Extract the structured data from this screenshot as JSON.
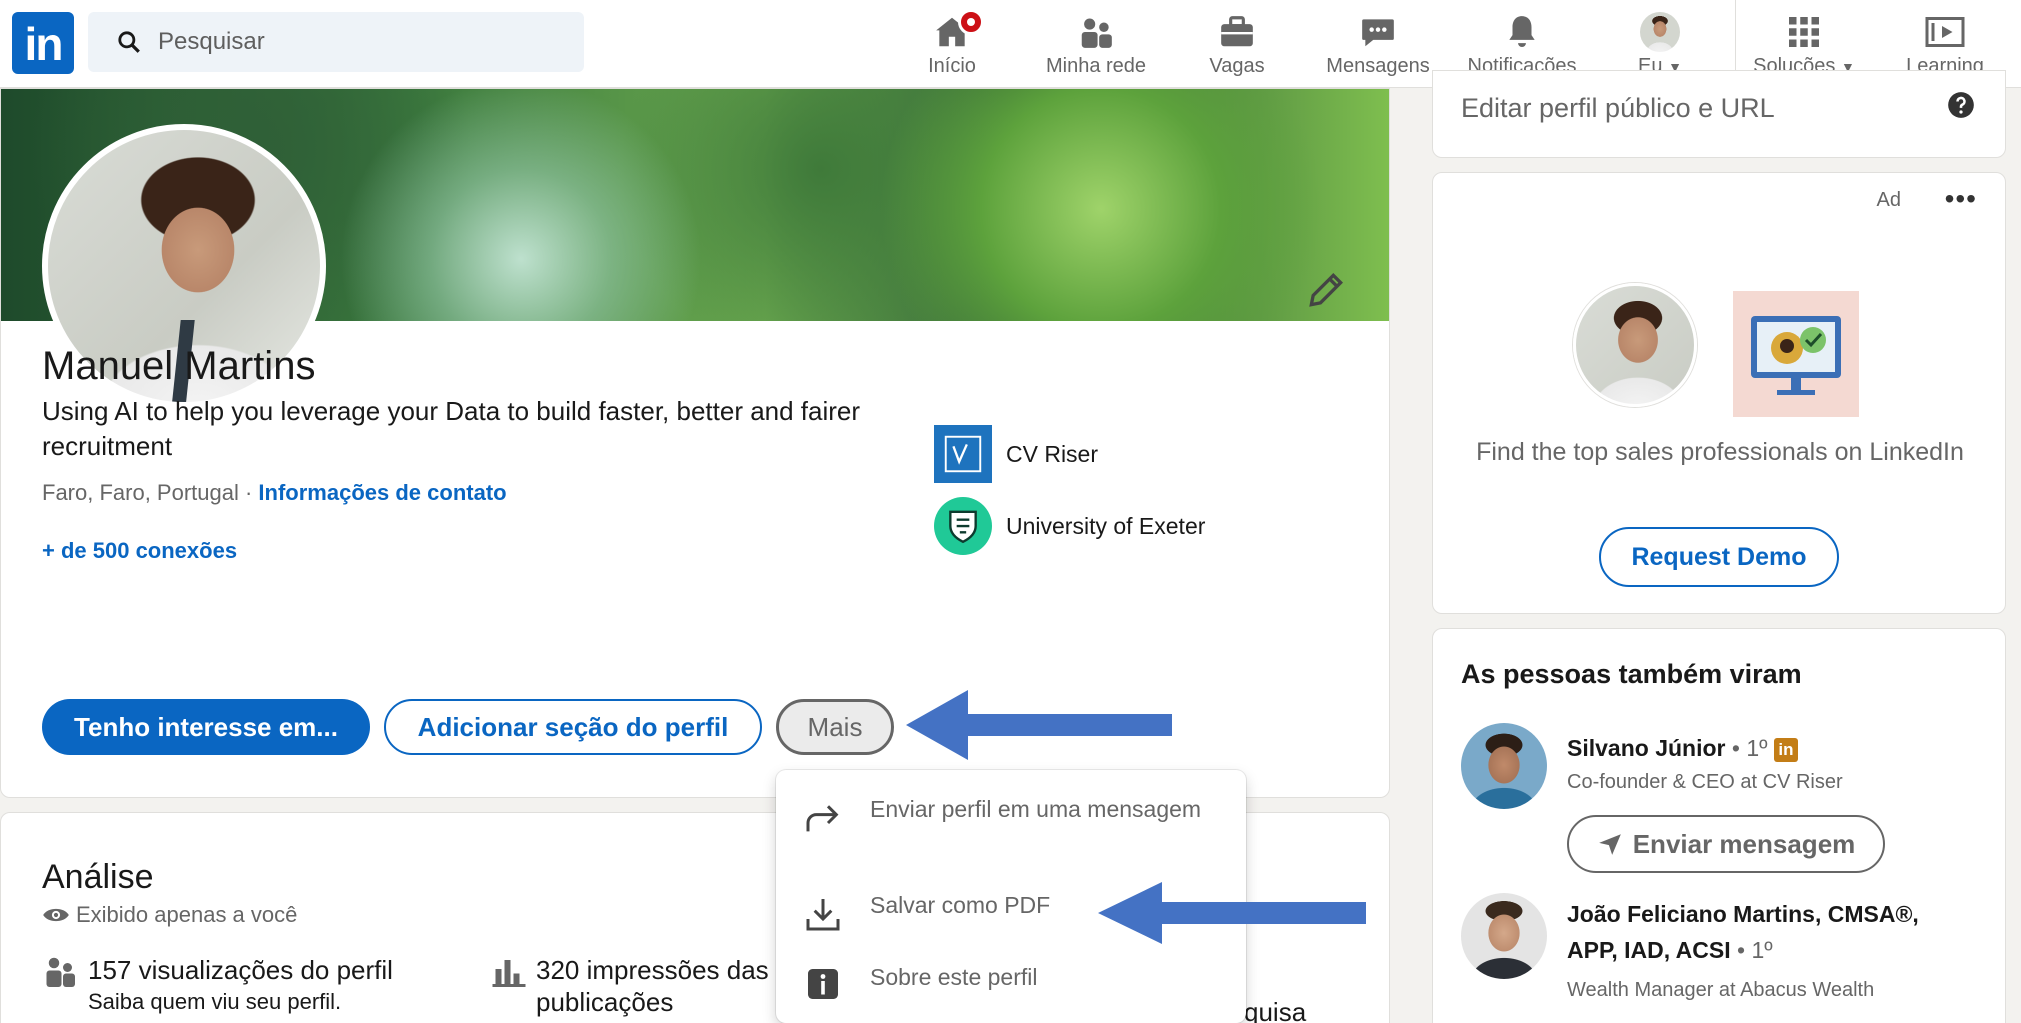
{
  "nav": {
    "search_placeholder": "Pesquisar",
    "items": [
      {
        "label": "Início",
        "icon": "home-icon"
      },
      {
        "label": "Minha rede",
        "icon": "network-icon"
      },
      {
        "label": "Vagas",
        "icon": "briefcase-icon"
      },
      {
        "label": "Mensagens",
        "icon": "chat-icon"
      },
      {
        "label": "Notificações",
        "icon": "bell-icon"
      },
      {
        "label": "Eu",
        "icon": "avatar"
      },
      {
        "label": "Soluções",
        "icon": "grid-icon"
      },
      {
        "label": "Learning",
        "icon": "learning-icon"
      }
    ]
  },
  "profile": {
    "name": "Manuel Martins",
    "headline": "Using AI to help you leverage your Data to build faster, better and fairer recruitment",
    "location": "Faro, Faro, Portugal · ",
    "contact_link": "Informações de contato",
    "connections": "+ de 500 conexões",
    "orgs": [
      {
        "name": "CV Riser"
      },
      {
        "name": "University of Exeter"
      }
    ],
    "buttons": {
      "interest": "Tenho interesse em...",
      "add_section": "Adicionar seção do perfil",
      "more": "Mais"
    }
  },
  "more_menu": {
    "items": [
      {
        "label": "Enviar perfil em uma mensagem",
        "icon": "share-arrow-icon"
      },
      {
        "label": "Salvar como PDF",
        "icon": "download-icon"
      },
      {
        "label": "Sobre este perfil",
        "icon": "info-icon"
      }
    ]
  },
  "analysis": {
    "title": "Análise",
    "visibility": "Exibido apenas a você",
    "stats": [
      {
        "title": "157 visualizações do perfil",
        "sub": "Saiba quem viu seu perfil."
      },
      {
        "title": "320 impressões das",
        "sub": "publicações"
      },
      {
        "title": "",
        "sub": "quisa"
      }
    ]
  },
  "sidebar": {
    "public_profile": "Editar perfil público e URL",
    "ad": {
      "label": "Ad",
      "text": "Find the top sales professionals on LinkedIn",
      "button": "Request Demo"
    },
    "people_also_viewed": {
      "title": "As pessoas também viram",
      "people": [
        {
          "name": "Silvano Júnior",
          "degree": " • 1º",
          "subtitle": "Co-founder & CEO at CV Riser",
          "button": "Enviar mensagem"
        },
        {
          "name": "João Feliciano Martins, CMSA®,",
          "name2": "APP, IAD, ACSI",
          "degree": " • 1º",
          "subtitle": "Wealth Manager at Abacus Wealth"
        }
      ]
    }
  },
  "colors": {
    "brand": "#0a66c2",
    "arrow": "#4472c4",
    "notification": "#cc1016"
  }
}
